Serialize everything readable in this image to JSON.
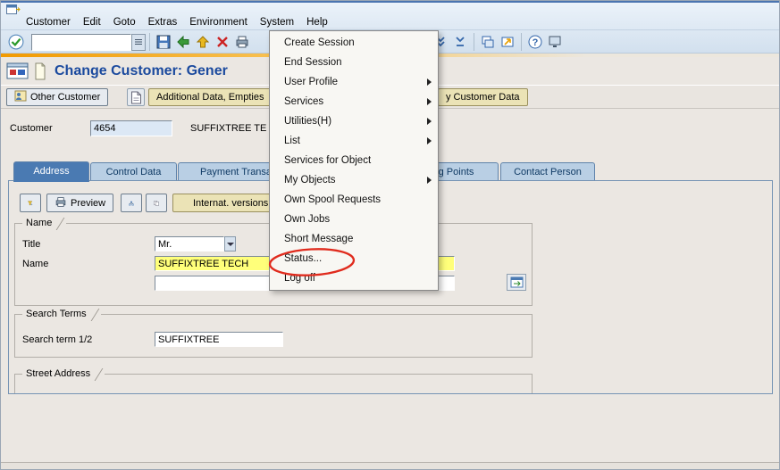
{
  "window": {
    "title": "Change Customer: Gener"
  },
  "colors": {
    "annotation": "#e02b1d",
    "active_tab": "#4a7ab2",
    "required_field": "#ffff7a",
    "accent_strip": "#f29a00"
  },
  "menubar": {
    "items": [
      "Customer",
      "Edit",
      "Goto",
      "Extras",
      "Environment",
      "System",
      "Help"
    ]
  },
  "toolbar": {
    "command_value": ""
  },
  "appbar": {
    "other_customer_label": "Other Customer",
    "additional_data_label": "Additional Data, Empties",
    "customer_data_label": "y Customer Data"
  },
  "customer": {
    "label": "Customer",
    "number": "4654",
    "name": "SUFFIXTREE TE"
  },
  "tabs": {
    "items": [
      "Address",
      "Control Data",
      "Payment Transa",
      "g Points",
      "Contact Person"
    ]
  },
  "content": {
    "preview_label": "Preview",
    "intl_versions_label": "Internat. versions",
    "name_group": {
      "label": "Name",
      "title_label": "Title",
      "title_value": "Mr.",
      "name_label": "Name",
      "name_value": "SUFFIXTREE TECH",
      "name2_value": ""
    },
    "search_group": {
      "label": "Search Terms",
      "term_label": "Search term 1/2",
      "term_value": "SUFFIXTREE"
    },
    "street_group": {
      "label": "Street Address"
    }
  },
  "system_menu": {
    "items": [
      "Create Session",
      "End Session",
      "User Profile",
      "Services",
      "Utilities(H)",
      "List",
      "Services for Object",
      "My Objects",
      "Own Spool Requests",
      "Own Jobs",
      "Short Message",
      "Status...",
      "Log off"
    ]
  }
}
